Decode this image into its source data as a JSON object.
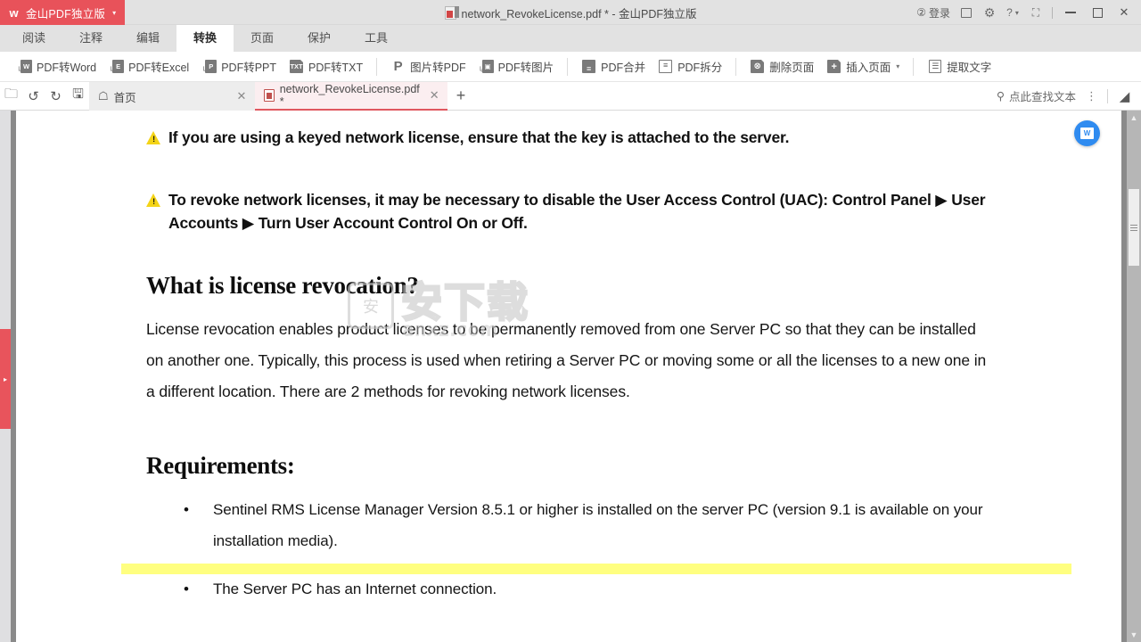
{
  "titlebar": {
    "brand_label": "金山PDF独立版",
    "brand_caret": "▾",
    "brand_color": "#e8525a",
    "doc_title": "network_RevokeLicense.pdf * - 金山PDF独立版",
    "login_label": "登录",
    "right_icons": [
      "account-login",
      "feedback",
      "settings-gear",
      "help",
      "fullscreen"
    ],
    "help_caret": "▾",
    "minimize": "—",
    "maximize": "□",
    "close": "✕"
  },
  "ribbon": {
    "tabs": [
      {
        "label": "阅读",
        "active": false
      },
      {
        "label": "注释",
        "active": false
      },
      {
        "label": "编辑",
        "active": false
      },
      {
        "label": "转换",
        "active": true
      },
      {
        "label": "页面",
        "active": false
      },
      {
        "label": "保护",
        "active": false
      },
      {
        "label": "工具",
        "active": false
      }
    ]
  },
  "toolbar": {
    "items": [
      {
        "label": "PDF转Word",
        "icon": "pdf-to-word-icon",
        "glyph": "W"
      },
      {
        "label": "PDF转Excel",
        "icon": "pdf-to-excel-icon",
        "glyph": "E"
      },
      {
        "label": "PDF转PPT",
        "icon": "pdf-to-ppt-icon",
        "glyph": "P"
      },
      {
        "label": "PDF转TXT",
        "icon": "pdf-to-txt-icon",
        "glyph": "TXT"
      },
      {
        "label": "图片转PDF",
        "icon": "image-to-pdf-icon",
        "glyph": "P"
      },
      {
        "label": "PDF转图片",
        "icon": "pdf-to-image-icon",
        "glyph": "▣"
      },
      {
        "label": "PDF合并",
        "icon": "merge-pdf-icon",
        "glyph": "≡"
      },
      {
        "label": "PDF拆分",
        "icon": "split-pdf-icon",
        "glyph": "≡"
      },
      {
        "label": "删除页面",
        "icon": "delete-page-icon",
        "glyph": "⊗"
      },
      {
        "label": "插入页面",
        "icon": "insert-page-icon",
        "glyph": "+",
        "caret": "▾"
      },
      {
        "label": "提取文字",
        "icon": "extract-text-icon",
        "glyph": "☰"
      }
    ]
  },
  "tabstrip": {
    "quick_buttons": [
      {
        "name": "open-folder-icon",
        "glyph": "🗀"
      },
      {
        "name": "undo-icon",
        "glyph": "↺"
      },
      {
        "name": "redo-icon",
        "glyph": "↻"
      },
      {
        "name": "save-icon",
        "glyph": "🖫"
      }
    ],
    "tabs": [
      {
        "label": "首页",
        "kind": "home",
        "active": false,
        "close": "✕"
      },
      {
        "label": "network_RevokeLicense.pdf *",
        "kind": "doc",
        "active": true,
        "close": "✕"
      }
    ],
    "new_tab": "+",
    "search_placeholder": "点此查找文本",
    "search_icon": "search-icon",
    "kebab": "⋮",
    "collapse_icon": "collapse-ribbon-icon"
  },
  "document": {
    "warnings": [
      "If you are using a keyed network license, ensure that the key is attached to the server.",
      "To revoke network licenses, it may be necessary to disable the User Access Control (UAC): Control Panel ▶ User Accounts ▶ Turn User Account Control On or Off."
    ],
    "heading_what": "What is license revocation?",
    "paragraph_what": "License revocation enables product licenses to be permanently removed from one Server PC so that they can be installed on another one. Typically, this process is used when retiring a Server PC or moving some or all the licenses to a new one in a different location. There are 2 methods for revoking network licenses.",
    "heading_requirements": "Requirements:",
    "requirements": [
      {
        "text": "Sentinel RMS License Manager Version 8.5.1 or higher is installed on the server PC (version 9.1 is available on your installation media).",
        "highlighted": false
      },
      {
        "text": "The Server PC has an Internet connection.",
        "highlighted": true
      }
    ],
    "watermark": {
      "badge": "安",
      "main": "安下载",
      "sub": "anxz.com"
    }
  },
  "viewer": {
    "left_rail_handle": "▸",
    "left_rail_handle_color": "#e8545c",
    "fab_icon": "pdf-to-word-fab-icon",
    "fab_glyph": "W",
    "fab_color": "#2f8bf0",
    "scroll_up": "▲",
    "scroll_down": "▼"
  }
}
